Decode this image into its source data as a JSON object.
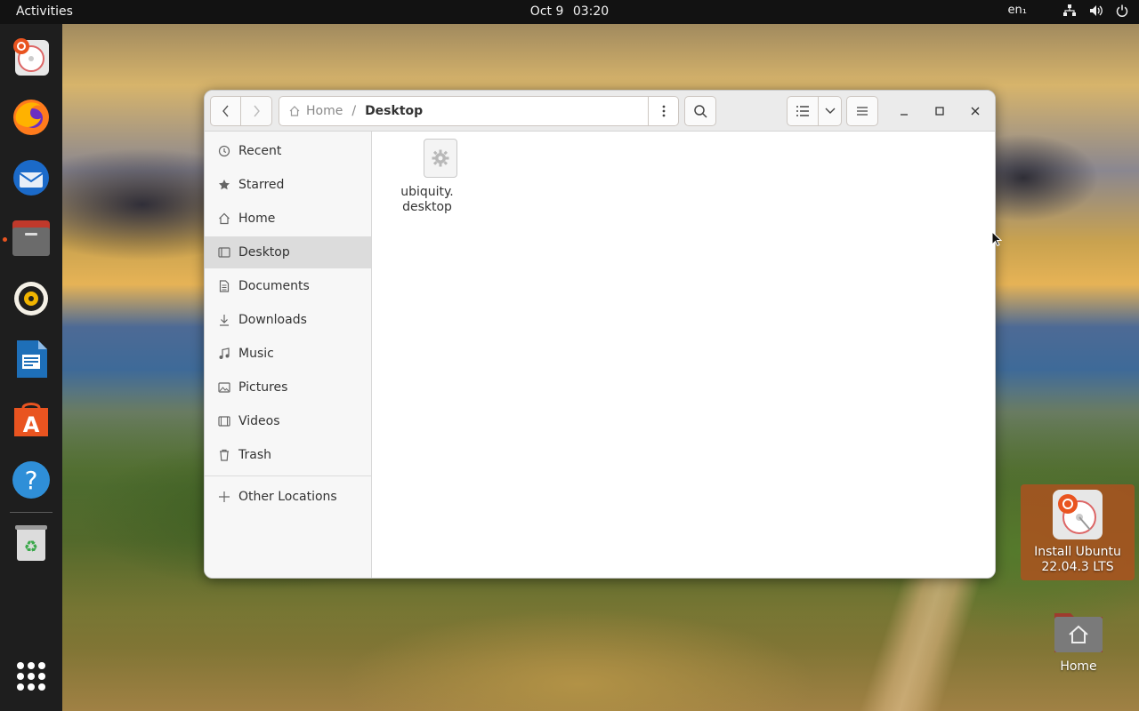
{
  "topbar": {
    "activities": "Activities",
    "date": "Oct 9",
    "time": "03:20",
    "lang": "en₁",
    "icons": [
      "network-icon",
      "volume-icon",
      "power-icon"
    ]
  },
  "dock": {
    "apps": [
      {
        "name": "Install Ubuntu",
        "icon": "ubuntu-installer-icon"
      },
      {
        "name": "Firefox",
        "icon": "firefox-icon"
      },
      {
        "name": "Thunderbird",
        "icon": "thunderbird-icon"
      },
      {
        "name": "Files",
        "icon": "files-icon",
        "running": true
      },
      {
        "name": "Rhythmbox",
        "icon": "rhythmbox-icon"
      },
      {
        "name": "LibreOffice Writer",
        "icon": "writer-icon"
      },
      {
        "name": "Ubuntu Software",
        "icon": "software-icon"
      },
      {
        "name": "Help",
        "icon": "help-icon"
      },
      {
        "name": "Trash",
        "icon": "trash-icon"
      }
    ],
    "show_apps": "apps-grid-icon"
  },
  "window": {
    "breadcrumb": {
      "home": "Home",
      "separator": "/",
      "current": "Desktop"
    },
    "sidebar": {
      "items": [
        {
          "label": "Recent",
          "icon": "clock-icon"
        },
        {
          "label": "Starred",
          "icon": "star-icon"
        },
        {
          "label": "Home",
          "icon": "home-icon"
        },
        {
          "label": "Desktop",
          "icon": "desktop-icon",
          "active": true
        },
        {
          "label": "Documents",
          "icon": "document-icon"
        },
        {
          "label": "Downloads",
          "icon": "download-icon"
        },
        {
          "label": "Music",
          "icon": "music-icon"
        },
        {
          "label": "Pictures",
          "icon": "picture-icon"
        },
        {
          "label": "Videos",
          "icon": "video-icon"
        },
        {
          "label": "Trash",
          "icon": "trash-icon"
        }
      ],
      "other": {
        "label": "Other Locations",
        "icon": "plus-icon"
      }
    },
    "files": [
      {
        "name_line1": "ubiquity.",
        "name_line2": "desktop",
        "icon": "gear-icon"
      }
    ]
  },
  "desktop": {
    "install": {
      "line1": "Install Ubuntu",
      "line2": "22.04.3 LTS"
    },
    "home": {
      "label": "Home"
    }
  },
  "colors": {
    "accent": "#e95420",
    "topbar": "#121212",
    "dock": "#1e1e1e",
    "sidebar_active": "#dcdcdc"
  }
}
